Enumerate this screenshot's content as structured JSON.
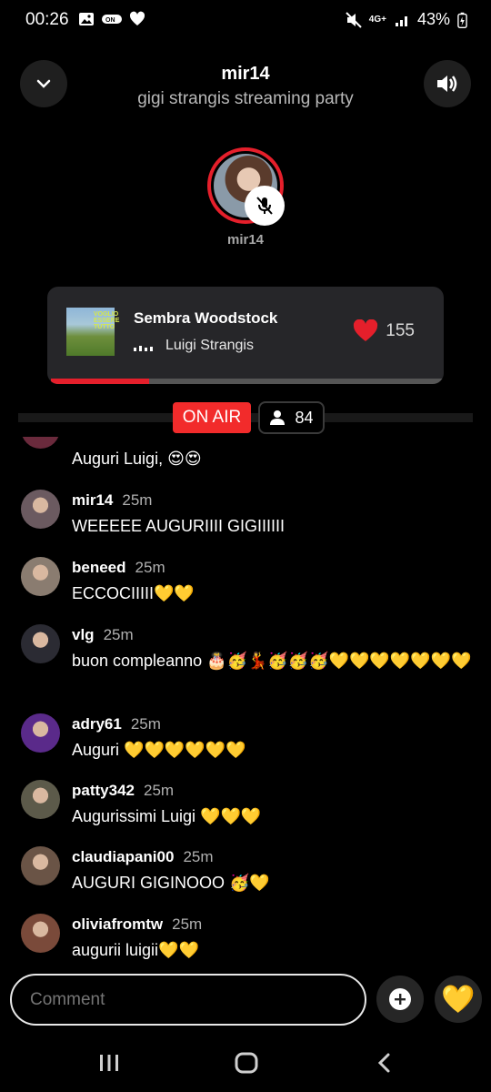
{
  "status_bar": {
    "time": "00:26",
    "network": "4G+",
    "battery": "43%"
  },
  "header": {
    "title": "mir14",
    "subtitle": "gigi strangis streaming party",
    "collapse_icon": "chevron-down-icon",
    "volume_icon": "volume-icon"
  },
  "host": {
    "name": "mir14",
    "mic_state": "muted"
  },
  "now_playing": {
    "track": "Sembra Woodstock",
    "artist": "Luigi Strangis",
    "likes": "155",
    "album_art_text": "VOGLIO ESSERE TUTTO",
    "progress_fraction": 0.25,
    "accent_color": "#e51f2b"
  },
  "live": {
    "on_air_label": "ON AIR",
    "listeners": "84"
  },
  "chat": {
    "messages": [
      {
        "user": "",
        "time": "",
        "text": "Auguri Luigi, 😍😍",
        "avatar": "#6a2a3c"
      },
      {
        "user": "mir14",
        "time": "25m",
        "text": "WEEEEE AUGURIIII GIGIIIIII",
        "avatar": "#6b5a60"
      },
      {
        "user": "beneed",
        "time": "25m",
        "text": "ECCOCIIIII💛💛",
        "avatar": "#8a7c70"
      },
      {
        "user": "vlg",
        "time": "25m",
        "text": "buon compleanno 🎂🥳💃🥳🥳🥳💛💛💛💛💛💛💛",
        "avatar": "#2b2b33"
      },
      {
        "user": "adry61",
        "time": "25m",
        "text": "Auguri 💛💛💛💛💛💛",
        "avatar": "#5a2a8a"
      },
      {
        "user": "patty342",
        "time": "25m",
        "text": "Augurissimi Luigi 💛💛💛",
        "avatar": "#5c5a4a"
      },
      {
        "user": "claudiapani00",
        "time": "25m",
        "text": "AUGURI GIGINOOO 🥳💛",
        "avatar": "#6a5446"
      },
      {
        "user": "oliviafromtw",
        "time": "25m",
        "text": "augurii luigii💛💛",
        "avatar": "#7a4a3a"
      }
    ]
  },
  "composer": {
    "placeholder": "Comment",
    "heart_emoji": "💛"
  }
}
